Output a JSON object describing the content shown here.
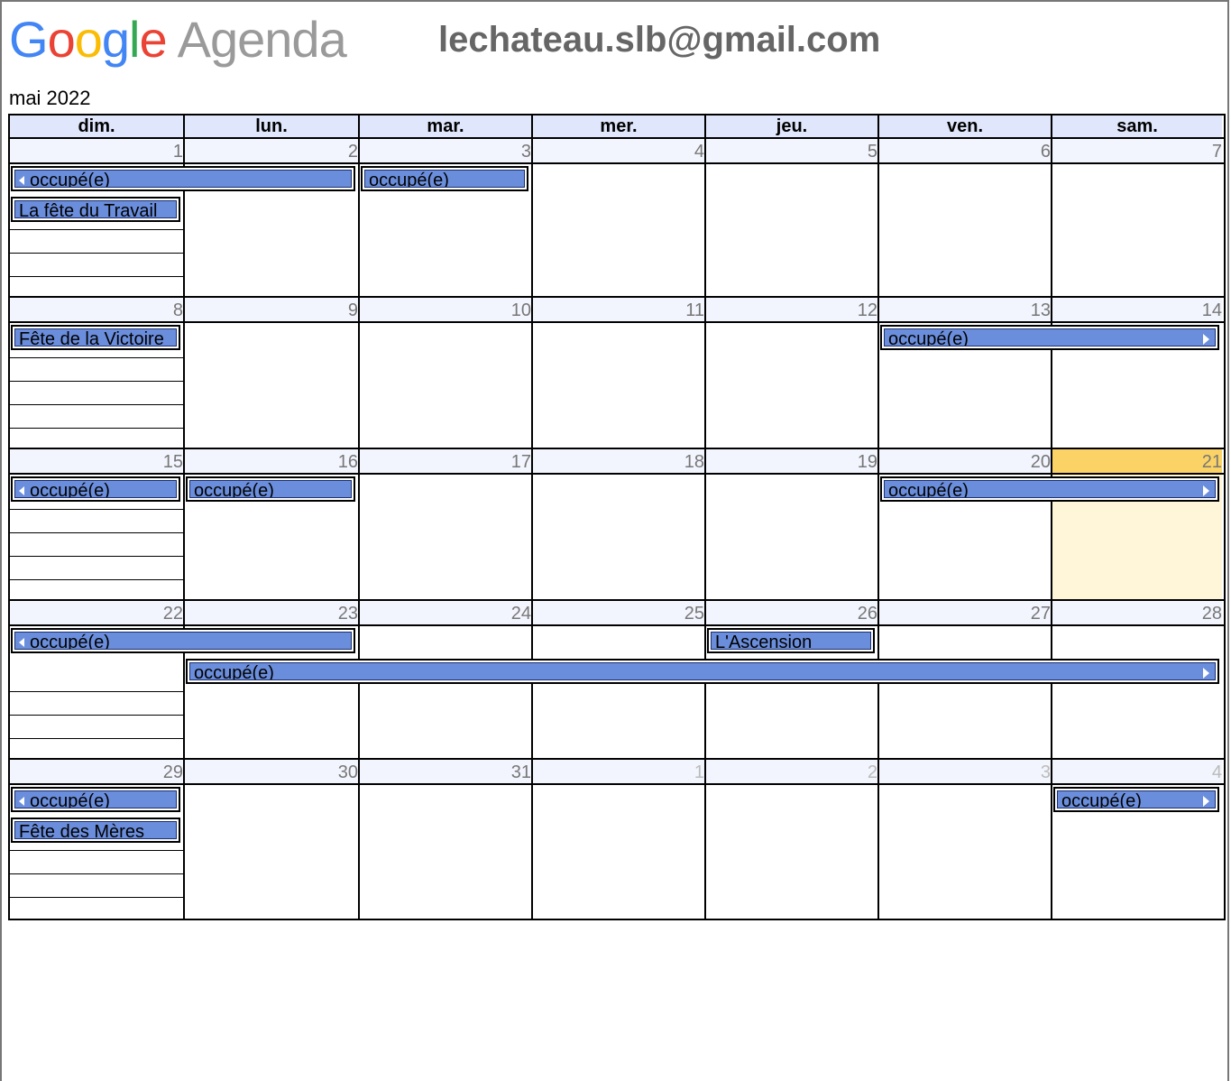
{
  "app": {
    "logo_letters": [
      {
        "ch": "G",
        "color": "#4285f4"
      },
      {
        "ch": "o",
        "color": "#ea4335"
      },
      {
        "ch": "o",
        "color": "#fbbc05"
      },
      {
        "ch": "g",
        "color": "#4285f4"
      },
      {
        "ch": "l",
        "color": "#34a853"
      },
      {
        "ch": "e",
        "color": "#ea4335"
      }
    ],
    "product": "Agenda",
    "email": "lechateau.slb@gmail.com"
  },
  "calendar": {
    "month_label": "mai 2022",
    "weekdays": [
      "dim.",
      "lun.",
      "mar.",
      "mer.",
      "jeu.",
      "ven.",
      "sam."
    ],
    "weeks": [
      {
        "days": [
          {
            "n": "1"
          },
          {
            "n": "2"
          },
          {
            "n": "3"
          },
          {
            "n": "4"
          },
          {
            "n": "5"
          },
          {
            "n": "6"
          },
          {
            "n": "7"
          }
        ],
        "events": [
          {
            "label": "occupé(e)",
            "start": 0,
            "span": 2,
            "row": 0,
            "cont_left": true,
            "cont_right": false
          },
          {
            "label": "occupé(e)",
            "start": 2,
            "span": 1,
            "row": 0,
            "cont_left": false,
            "cont_right": false
          },
          {
            "label": "La fête du Travail",
            "start": 0,
            "span": 1,
            "row": 1,
            "cont_left": false,
            "cont_right": false
          }
        ]
      },
      {
        "days": [
          {
            "n": "8"
          },
          {
            "n": "9"
          },
          {
            "n": "10"
          },
          {
            "n": "11"
          },
          {
            "n": "12"
          },
          {
            "n": "13"
          },
          {
            "n": "14"
          }
        ],
        "events": [
          {
            "label": "Fête de la Victoire",
            "start": 0,
            "span": 1,
            "row": 0,
            "cont_left": false,
            "cont_right": false
          },
          {
            "label": "occupé(e)",
            "start": 5,
            "span": 2,
            "row": 0,
            "cont_left": false,
            "cont_right": true
          }
        ]
      },
      {
        "days": [
          {
            "n": "15"
          },
          {
            "n": "16"
          },
          {
            "n": "17"
          },
          {
            "n": "18"
          },
          {
            "n": "19"
          },
          {
            "n": "20"
          },
          {
            "n": "21",
            "today": true
          }
        ],
        "events": [
          {
            "label": "occupé(e)",
            "start": 0,
            "span": 1,
            "row": 0,
            "cont_left": true,
            "cont_right": false
          },
          {
            "label": "occupé(e)",
            "start": 1,
            "span": 1,
            "row": 0,
            "cont_left": false,
            "cont_right": false
          },
          {
            "label": "occupé(e)",
            "start": 5,
            "span": 2,
            "row": 0,
            "cont_left": false,
            "cont_right": true
          }
        ]
      },
      {
        "days": [
          {
            "n": "22"
          },
          {
            "n": "23"
          },
          {
            "n": "24"
          },
          {
            "n": "25"
          },
          {
            "n": "26"
          },
          {
            "n": "27"
          },
          {
            "n": "28"
          }
        ],
        "events": [
          {
            "label": "occupé(e)",
            "start": 0,
            "span": 2,
            "row": 0,
            "cont_left": true,
            "cont_right": false
          },
          {
            "label": "L'Ascension",
            "start": 4,
            "span": 1,
            "row": 0,
            "cont_left": false,
            "cont_right": false
          },
          {
            "label": "occupé(e)",
            "start": 1,
            "span": 6,
            "row": 1,
            "cont_left": false,
            "cont_right": true
          }
        ]
      },
      {
        "days": [
          {
            "n": "29"
          },
          {
            "n": "30"
          },
          {
            "n": "31"
          },
          {
            "n": "1",
            "other": true
          },
          {
            "n": "2",
            "other": true
          },
          {
            "n": "3",
            "other": true
          },
          {
            "n": "4",
            "other": true
          }
        ],
        "events": [
          {
            "label": "occupé(e)",
            "start": 0,
            "span": 1,
            "row": 0,
            "cont_left": true,
            "cont_right": false
          },
          {
            "label": "occupé(e)",
            "start": 6,
            "span": 1,
            "row": 0,
            "cont_left": false,
            "cont_right": true
          },
          {
            "label": "Fête des Mères",
            "start": 0,
            "span": 1,
            "row": 1,
            "cont_left": false,
            "cont_right": false
          }
        ]
      }
    ]
  }
}
